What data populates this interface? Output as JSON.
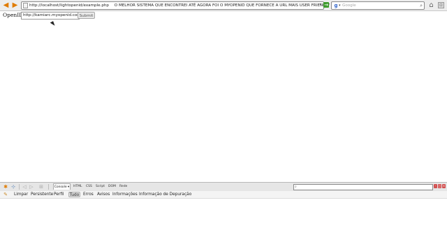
{
  "browser": {
    "url": "http://localhost/lightopenid/example.php",
    "url_annotation": "O MELHOR SISTEMA QUE ENCONTREI ATÉ AGORA FOI O MYOPENID QUE FORNECE A URL MAIS USER FRIENDLY",
    "search_placeholder": "Google",
    "search_engine_icon": "google-icon",
    "accent_color": "#e07b00"
  },
  "page": {
    "openid_label": "OpenID:",
    "openid_value": "http://kamiarc.myopenid.com/",
    "submit_label": "Submit"
  },
  "firebug": {
    "tabs": {
      "console": "Console ▾",
      "html": "HTML",
      "css": "CSS",
      "script": "Script",
      "dom": "DOM",
      "net": "Rede"
    },
    "console_bar": {
      "clear": "Limpar",
      "persist": "Persistente",
      "profile": "Perfil",
      "all": "Tudo",
      "errors": "Erros",
      "warnings": "Avisos",
      "info": "Informações",
      "debug": "Informação de Depuração"
    }
  }
}
